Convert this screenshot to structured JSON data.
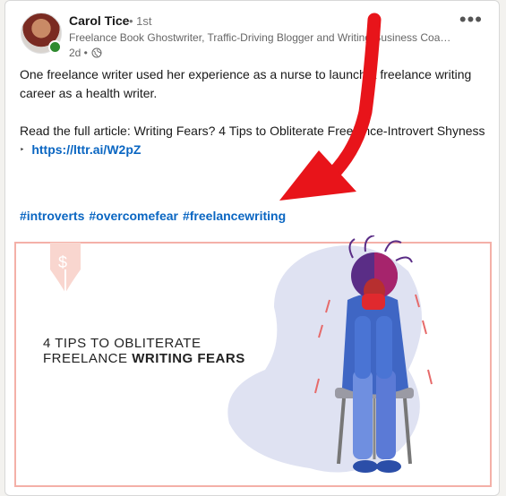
{
  "post": {
    "author": {
      "name": "Carol Tice",
      "degree": "• 1st",
      "headline": "Freelance Book Ghostwriter, Traffic-Driving Blogger and Writing Business Coac...",
      "time": "2d •"
    },
    "text_line1": "One freelance writer used her experience as a nurse to launch a freelance writing career as a health writer.",
    "article_text": "Read the full article: Writing Fears? 4 Tips to Obliterate Freelance-Introvert Shyness",
    "bullet": "‣",
    "link": "https://lttr.ai/W2pZ",
    "hashtags": [
      "#introverts",
      "#overcomefear",
      "#freelancewriting"
    ],
    "image": {
      "line1": "4 TIPS TO OBLITERATE",
      "line2_prefix": "FREELANCE ",
      "line2_bold": "WRITING FEARS"
    }
  },
  "menu_icon": "more-horizontal-icon",
  "colors": {
    "link": "#0a66c2",
    "arrow": "#e8141a",
    "frame": "#f4b0a8"
  }
}
